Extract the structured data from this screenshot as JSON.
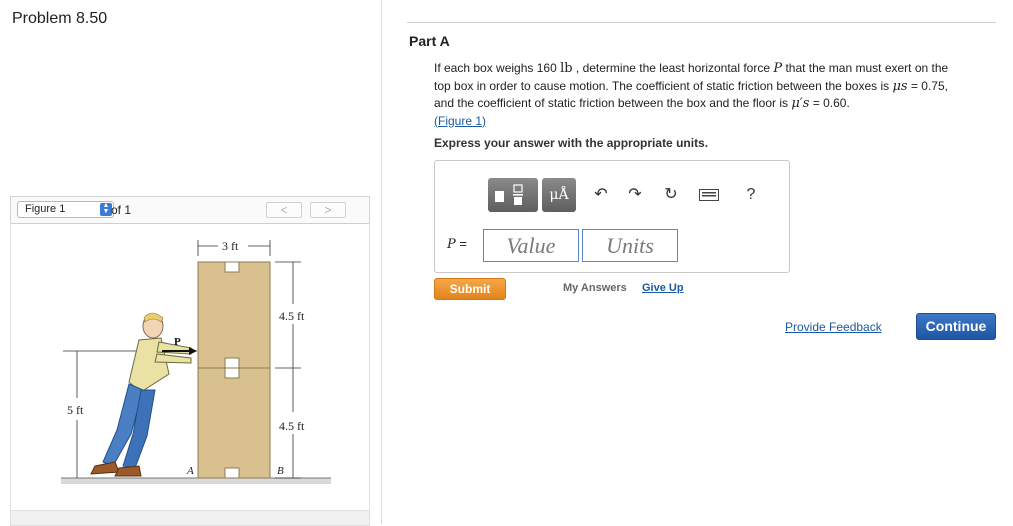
{
  "problem": {
    "title": "Problem 8.50"
  },
  "figure_bar": {
    "select_value": "Figure 1",
    "of_label": "of 1",
    "prev_label": "<",
    "next_label": ">"
  },
  "figure": {
    "dim_top": "3 ft",
    "dim_upper": "4.5 ft",
    "dim_lower": "4.5 ft",
    "dim_height": "5 ft",
    "force_label": "P",
    "point_a": "A",
    "point_b": "B"
  },
  "part": {
    "title": "Part A",
    "q_line1_a": "If each box weighs 160 ",
    "q_unit": "lb",
    "q_line1_b": " , determine the least horizontal force ",
    "q_var": "P",
    "q_line1_c": " that the man must exert on the",
    "q_line2": "top box in order to cause motion. The coefficient of static friction between the boxes is ",
    "q_mu_s": "μs",
    "q_line2_b": " = 0.75,",
    "q_line3": "and the coefficient of static friction between the box and the floor is ",
    "q_mu_s_prime": "μ′s",
    "q_line3_b": " = 0.60.",
    "figure_link": "(Figure 1)",
    "express": "Express your answer with the appropriate units."
  },
  "toolbar": {
    "mu_label": "μÅ",
    "help_label": "?"
  },
  "answer": {
    "label_var": "P",
    "label_eq": " =",
    "value_placeholder": "Value",
    "units_placeholder": "Units"
  },
  "actions": {
    "submit": "Submit",
    "my_answers": "My Answers",
    "give_up": "Give Up",
    "feedback": "Provide Feedback",
    "continue": "Continue"
  }
}
